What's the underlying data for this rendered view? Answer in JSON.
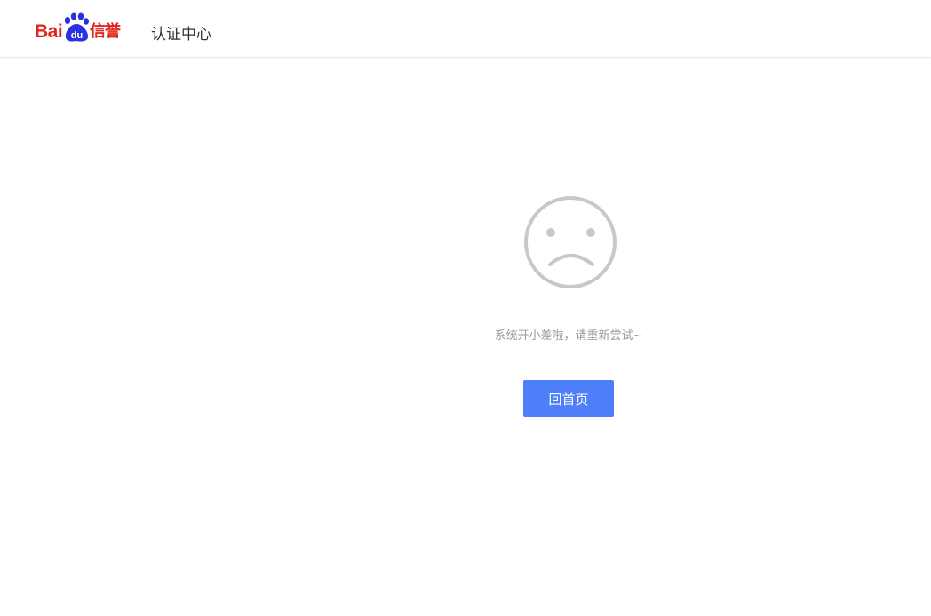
{
  "header": {
    "logo": {
      "brand_prefix": "Bai",
      "brand_paw_text": "du",
      "brand_suffix": "信誉",
      "icon": "baidu-paw-icon",
      "colors": {
        "red": "#e1251b",
        "blue": "#2932e1"
      }
    },
    "title": "认证中心"
  },
  "error": {
    "icon": "sad-face-icon",
    "icon_color": "#c8c8c8",
    "message": "系统开小差啦，请重新尝试~"
  },
  "actions": {
    "home_label": "回首页",
    "home_color": "#4e7ef8"
  }
}
